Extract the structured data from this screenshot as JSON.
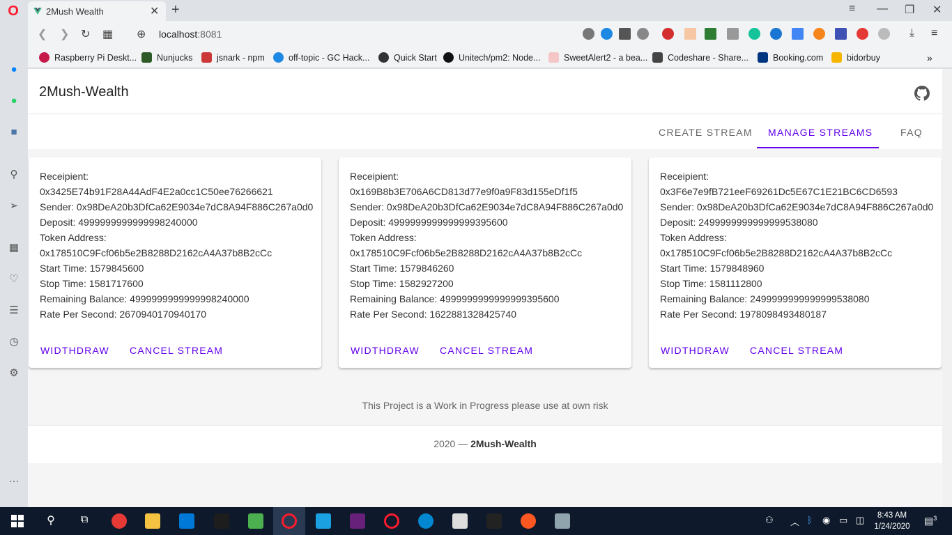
{
  "browser": {
    "tab_title": "2Mush Wealth",
    "url_host": "localhost",
    "url_port": ":8081",
    "bookmarks": [
      "Raspberry Pi Deskt...",
      "Nunjucks",
      "jsnark - npm",
      "off-topic - GC Hack...",
      "Quick Start",
      "Unitech/pm2: Node...",
      "SweetAlert2 - a bea...",
      "Codeshare - Share...",
      "Booking.com",
      "bidorbuy"
    ],
    "extensions": [
      "camera-icon",
      "shield-icon",
      "send-icon",
      "heart-icon",
      "adblock-icon",
      "cube-icon",
      "vue-icon",
      "search-extension-icon",
      "grammarly-icon",
      "compass-icon",
      "translate-icon",
      "metamask-icon",
      "zotero-icon",
      "stop-icon",
      "puzzle-icon",
      "download-icon",
      "menu-icon"
    ]
  },
  "app": {
    "title": "2Mush-Wealth",
    "nav": {
      "create": "CREATE STREAM",
      "manage": "MANAGE STREAMS",
      "faq": "FAQ"
    },
    "streams": [
      {
        "recipient_label": "Receipient:",
        "recipient": "0x3425E74b91F28A44AdF4E2a0cc1C50ee76266621",
        "sender": "Sender: 0x98DeA20b3DfCa62E9034e7dC8A94F886C267a0d0",
        "deposit": "Deposit: 4999999999999998240000",
        "token_label": "Token Address:",
        "token": "0x178510C9Fcf06b5e2B8288D2162cA4A37b8B2cCc",
        "start": "Start Time: 1579845600",
        "stop": "Stop Time: 1581717600",
        "remaining": "Remaining Balance: 4999999999999998240000",
        "rate": "Rate Per Second: 2670940170940170",
        "withdraw": "WIDTHDRAW",
        "cancel": "CANCEL STREAM"
      },
      {
        "recipient_label": "Receipient:",
        "recipient": "0x169B8b3E706A6CD813d77e9f0a9F83d155eDf1f5",
        "sender": "Sender: 0x98DeA20b3DfCa62E9034e7dC8A94F886C267a0d0",
        "deposit": "Deposit: 4999999999999999395600",
        "token_label": "Token Address:",
        "token": "0x178510C9Fcf06b5e2B8288D2162cA4A37b8B2cCc",
        "start": "Start Time: 1579846260",
        "stop": "Stop Time: 1582927200",
        "remaining": "Remaining Balance: 4999999999999999395600",
        "rate": "Rate Per Second: 1622881328425740",
        "withdraw": "WIDTHDRAW",
        "cancel": "CANCEL STREAM"
      },
      {
        "recipient_label": "Receipient:",
        "recipient": "0x3F6e7e9fB721eeF69261Dc5E67C1E21BC6CD6593",
        "sender": "Sender: 0x98DeA20b3DfCa62E9034e7dC8A94F886C267a0d0",
        "deposit": "Deposit: 2499999999999999538080",
        "token_label": "Token Address:",
        "token": "0x178510C9Fcf06b5e2B8288D2162cA4A37b8B2cCc",
        "start": "Start Time: 1579848960",
        "stop": "Stop Time: 1581112800",
        "remaining": "Remaining Balance: 2499999999999999538080",
        "rate": "Rate Per Second: 1978098493480187",
        "withdraw": "WIDTHDRAW",
        "cancel": "CANCEL STREAM"
      }
    ],
    "disclaimer": "This Project is a Work in Progress please use at own risk",
    "footer_year": "2020 —",
    "footer_name": "2Mush-Wealth"
  },
  "taskbar": {
    "time": "8:43 AM",
    "date": "1/24/2020",
    "notifications": "3"
  },
  "colors": {
    "accent": "#6200ea",
    "opera_red": "#ff1b2d",
    "taskbar": "#0e1a2b"
  }
}
